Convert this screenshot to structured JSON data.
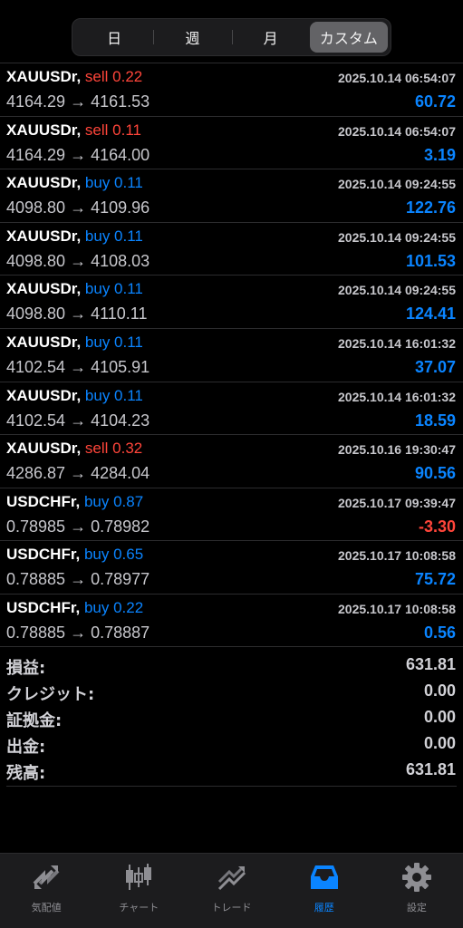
{
  "segments": [
    {
      "label": "日"
    },
    {
      "label": "週"
    },
    {
      "label": "月"
    },
    {
      "label": "カスタム",
      "active": true
    }
  ],
  "trades": [
    {
      "symbol": "XAUUSDr,",
      "side": "sell",
      "side_label": "sell 0.22",
      "time": "2025.10.14 06:54:07",
      "prices": "4164.29 → 4161.53",
      "profit": "60.72"
    },
    {
      "symbol": "XAUUSDr,",
      "side": "sell",
      "side_label": "sell 0.11",
      "time": "2025.10.14 06:54:07",
      "prices": "4164.29 → 4164.00",
      "profit": "3.19"
    },
    {
      "symbol": "XAUUSDr,",
      "side": "buy",
      "side_label": "buy 0.11",
      "time": "2025.10.14 09:24:55",
      "prices": "4098.80 → 4109.96",
      "profit": "122.76"
    },
    {
      "symbol": "XAUUSDr,",
      "side": "buy",
      "side_label": "buy 0.11",
      "time": "2025.10.14 09:24:55",
      "prices": "4098.80 → 4108.03",
      "profit": "101.53"
    },
    {
      "symbol": "XAUUSDr,",
      "side": "buy",
      "side_label": "buy 0.11",
      "time": "2025.10.14 09:24:55",
      "prices": "4098.80 → 4110.11",
      "profit": "124.41"
    },
    {
      "symbol": "XAUUSDr,",
      "side": "buy",
      "side_label": "buy 0.11",
      "time": "2025.10.14 16:01:32",
      "prices": "4102.54 → 4105.91",
      "profit": "37.07"
    },
    {
      "symbol": "XAUUSDr,",
      "side": "buy",
      "side_label": "buy 0.11",
      "time": "2025.10.14 16:01:32",
      "prices": "4102.54 → 4104.23",
      "profit": "18.59"
    },
    {
      "symbol": "XAUUSDr,",
      "side": "sell",
      "side_label": "sell 0.32",
      "time": "2025.10.16 19:30:47",
      "prices": "4286.87 → 4284.04",
      "profit": "90.56"
    },
    {
      "symbol": "USDCHFr,",
      "side": "buy",
      "side_label": "buy 0.87",
      "time": "2025.10.17 09:39:47",
      "prices": "0.78985 → 0.78982",
      "profit": "-3.30"
    },
    {
      "symbol": "USDCHFr,",
      "side": "buy",
      "side_label": "buy 0.65",
      "time": "2025.10.17 10:08:58",
      "prices": "0.78885 → 0.78977",
      "profit": "75.72"
    },
    {
      "symbol": "USDCHFr,",
      "side": "buy",
      "side_label": "buy 0.22",
      "time": "2025.10.17 10:08:58",
      "prices": "0.78885 → 0.78887",
      "profit": "0.56"
    }
  ],
  "summary": [
    {
      "label": "損益:",
      "value": "631.81"
    },
    {
      "label": "クレジット:",
      "value": "0.00"
    },
    {
      "label": "証拠金:",
      "value": "0.00"
    },
    {
      "label": "出金:",
      "value": "0.00"
    },
    {
      "label": "残高:",
      "value": "631.81"
    }
  ],
  "tabs": [
    {
      "label": "気配値",
      "icon": "quotes-icon"
    },
    {
      "label": "チャート",
      "icon": "candlestick-icon"
    },
    {
      "label": "トレード",
      "icon": "trade-icon"
    },
    {
      "label": "履歴",
      "icon": "history-inbox-icon",
      "active": true
    },
    {
      "label": "設定",
      "icon": "gear-icon"
    }
  ],
  "colors": {
    "buy": "#0a84ff",
    "sell": "#ff453a",
    "active_tab": "#0a84ff"
  }
}
